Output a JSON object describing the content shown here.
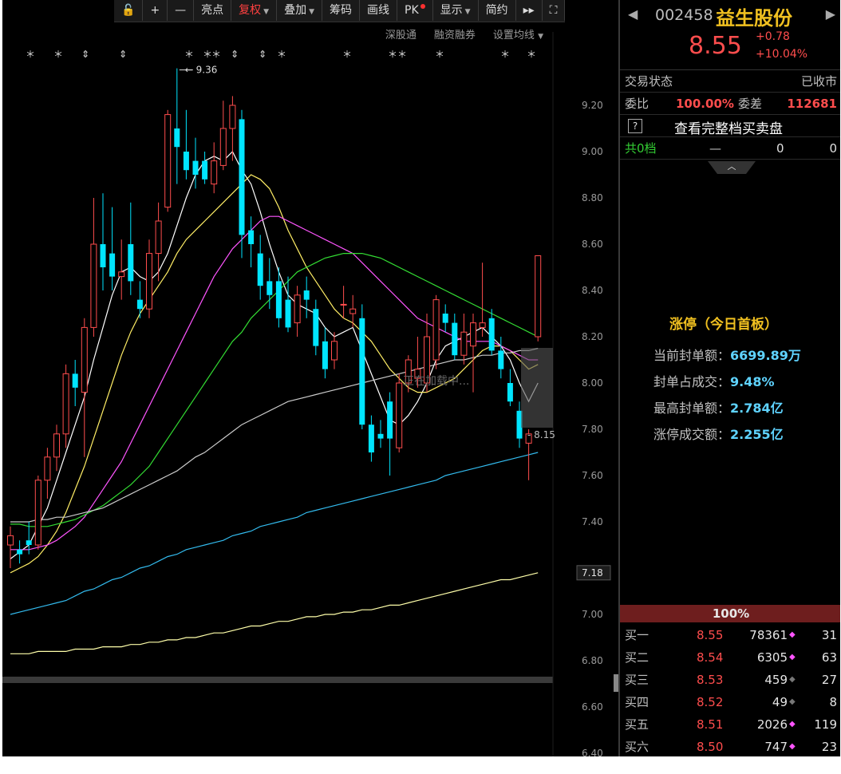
{
  "toolbar": {
    "items": [
      {
        "label": "亮点",
        "caret": false,
        "active": false
      },
      {
        "label": "复权",
        "caret": true,
        "active": true
      },
      {
        "label": "叠加",
        "caret": true,
        "active": false
      },
      {
        "label": "筹码",
        "caret": false,
        "active": false
      },
      {
        "label": "画线",
        "caret": false,
        "active": false
      },
      {
        "label": "PK",
        "caret": false,
        "active": false,
        "dot": true
      },
      {
        "label": "显示",
        "caret": true,
        "active": false
      },
      {
        "label": "简约",
        "caret": false,
        "active": false
      }
    ],
    "icons": [
      "lock-icon",
      "zoom-in-icon",
      "zoom-out-icon",
      "fast-forward-icon",
      "fullscreen-icon"
    ]
  },
  "subtool": {
    "items": [
      "深股通",
      "融资融券",
      "设置均线"
    ]
  },
  "chart_data": {
    "type": "candlestick",
    "y_ticks": [
      "9.20",
      "9.00",
      "8.80",
      "8.60",
      "8.40",
      "8.20",
      "8.00",
      "7.80",
      "7.60",
      "7.40",
      "7.00",
      "6.80",
      "6.60",
      "6.40"
    ],
    "y_tick_values": [
      9.2,
      9.0,
      8.8,
      8.6,
      8.4,
      8.2,
      8.0,
      7.8,
      7.6,
      7.4,
      7.0,
      6.8,
      6.6,
      6.4
    ],
    "ylim": [
      6.4,
      9.2
    ],
    "current_price_label": "7.18",
    "high_annotation": "9.36",
    "low_annotation": "8.15",
    "loading_text": "正在加载中...",
    "colors": {
      "up": "#ff4d4d",
      "down": "#00e5ff",
      "ma5": "#ffffff",
      "ma10": "#ffee66",
      "ma20": "#ff55ff",
      "ma30": "#33dd33",
      "ma60": "#cccccc",
      "ma120": "#33bbee",
      "ma250": "#ffffaa"
    },
    "candles": [
      {
        "o": 7.3,
        "h": 7.38,
        "l": 7.2,
        "c": 7.34
      },
      {
        "o": 7.28,
        "h": 7.32,
        "l": 7.22,
        "c": 7.26
      },
      {
        "o": 7.32,
        "h": 7.4,
        "l": 7.26,
        "c": 7.3
      },
      {
        "o": 7.3,
        "h": 7.6,
        "l": 7.28,
        "c": 7.58
      },
      {
        "o": 7.58,
        "h": 7.72,
        "l": 7.5,
        "c": 7.68
      },
      {
        "o": 7.68,
        "h": 7.82,
        "l": 7.62,
        "c": 7.78
      },
      {
        "o": 7.78,
        "h": 8.08,
        "l": 7.72,
        "c": 8.04
      },
      {
        "o": 8.04,
        "h": 8.1,
        "l": 7.9,
        "c": 7.98
      },
      {
        "o": 7.96,
        "h": 8.28,
        "l": 7.68,
        "c": 8.24
      },
      {
        "o": 8.24,
        "h": 8.8,
        "l": 8.2,
        "c": 8.6
      },
      {
        "o": 8.6,
        "h": 8.82,
        "l": 8.4,
        "c": 8.5
      },
      {
        "o": 8.56,
        "h": 8.76,
        "l": 8.4,
        "c": 8.46
      },
      {
        "o": 8.46,
        "h": 8.62,
        "l": 8.36,
        "c": 8.48
      },
      {
        "o": 8.6,
        "h": 8.78,
        "l": 8.38,
        "c": 8.44
      },
      {
        "o": 8.36,
        "h": 8.44,
        "l": 8.28,
        "c": 8.32
      },
      {
        "o": 8.32,
        "h": 8.62,
        "l": 8.28,
        "c": 8.56
      },
      {
        "o": 8.56,
        "h": 8.78,
        "l": 8.44,
        "c": 8.7
      },
      {
        "o": 8.76,
        "h": 9.18,
        "l": 8.74,
        "c": 9.16
      },
      {
        "o": 9.1,
        "h": 9.36,
        "l": 8.86,
        "c": 9.02
      },
      {
        "o": 9.0,
        "h": 9.18,
        "l": 8.88,
        "c": 8.92
      },
      {
        "o": 8.96,
        "h": 9.06,
        "l": 8.84,
        "c": 8.9
      },
      {
        "o": 8.96,
        "h": 9.0,
        "l": 8.86,
        "c": 8.88
      },
      {
        "o": 8.86,
        "h": 9.04,
        "l": 8.82,
        "c": 8.96
      },
      {
        "o": 8.94,
        "h": 9.22,
        "l": 8.92,
        "c": 9.1
      },
      {
        "o": 9.1,
        "h": 9.24,
        "l": 8.96,
        "c": 9.2
      },
      {
        "o": 9.14,
        "h": 9.18,
        "l": 8.54,
        "c": 8.64
      },
      {
        "o": 8.66,
        "h": 8.72,
        "l": 8.5,
        "c": 8.6
      },
      {
        "o": 8.56,
        "h": 8.64,
        "l": 8.36,
        "c": 8.42
      },
      {
        "o": 8.44,
        "h": 8.54,
        "l": 8.32,
        "c": 8.38
      },
      {
        "o": 8.44,
        "h": 8.5,
        "l": 8.24,
        "c": 8.28
      },
      {
        "o": 8.36,
        "h": 8.46,
        "l": 8.22,
        "c": 8.24
      },
      {
        "o": 8.26,
        "h": 8.42,
        "l": 8.2,
        "c": 8.38
      },
      {
        "o": 8.4,
        "h": 8.46,
        "l": 8.28,
        "c": 8.36
      },
      {
        "o": 8.32,
        "h": 8.36,
        "l": 8.12,
        "c": 8.16
      },
      {
        "o": 8.18,
        "h": 8.24,
        "l": 8.02,
        "c": 8.06
      },
      {
        "o": 8.1,
        "h": 8.22,
        "l": 8.06,
        "c": 8.18
      },
      {
        "o": 8.34,
        "h": 8.42,
        "l": 8.28,
        "c": 8.34
      },
      {
        "o": 8.3,
        "h": 8.38,
        "l": 8.24,
        "c": 8.32
      },
      {
        "o": 8.28,
        "h": 8.34,
        "l": 7.8,
        "c": 7.82
      },
      {
        "o": 7.82,
        "h": 7.86,
        "l": 7.66,
        "c": 7.7
      },
      {
        "o": 7.78,
        "h": 7.84,
        "l": 7.72,
        "c": 7.76
      },
      {
        "o": 7.92,
        "h": 7.96,
        "l": 7.6,
        "c": 7.76
      },
      {
        "o": 7.72,
        "h": 8.04,
        "l": 7.7,
        "c": 8.0
      },
      {
        "o": 8.0,
        "h": 8.12,
        "l": 7.96,
        "c": 8.1
      },
      {
        "o": 8.02,
        "h": 8.2,
        "l": 7.98,
        "c": 8.06
      },
      {
        "o": 8.0,
        "h": 8.3,
        "l": 7.96,
        "c": 8.2
      },
      {
        "o": 8.1,
        "h": 8.38,
        "l": 8.06,
        "c": 8.36
      },
      {
        "o": 8.3,
        "h": 8.34,
        "l": 8.22,
        "c": 8.26
      },
      {
        "o": 8.26,
        "h": 8.3,
        "l": 8.1,
        "c": 8.12
      },
      {
        "o": 8.12,
        "h": 8.3,
        "l": 8.08,
        "c": 8.22
      },
      {
        "o": 8.16,
        "h": 8.3,
        "l": 7.96,
        "c": 8.26
      },
      {
        "o": 8.24,
        "h": 8.52,
        "l": 8.2,
        "c": 8.26
      },
      {
        "o": 8.28,
        "h": 8.32,
        "l": 8.12,
        "c": 8.14
      },
      {
        "o": 8.14,
        "h": 8.2,
        "l": 8.02,
        "c": 8.06
      },
      {
        "o": 8.0,
        "h": 8.06,
        "l": 7.9,
        "c": 7.92
      },
      {
        "o": 7.88,
        "h": 7.92,
        "l": 7.72,
        "c": 7.76
      },
      {
        "o": 7.74,
        "h": 7.8,
        "l": 7.58,
        "c": 7.78
      },
      {
        "o": 8.2,
        "h": 8.55,
        "l": 8.18,
        "c": 8.55
      }
    ],
    "ma_lines": [
      {
        "name": "ma5",
        "y": [
          7.24,
          7.27,
          7.3,
          7.38,
          7.46,
          7.58,
          7.7,
          7.82,
          7.94,
          8.1,
          8.24,
          8.38,
          8.48,
          8.5,
          8.46,
          8.44,
          8.48,
          8.56,
          8.68,
          8.8,
          8.9,
          8.96,
          8.98,
          8.96,
          9.0,
          8.92,
          8.86,
          8.74,
          8.6,
          8.48,
          8.38,
          8.34,
          8.32,
          8.3,
          8.24,
          8.2,
          8.22,
          8.24,
          8.14,
          8.04,
          7.94,
          7.84,
          7.82,
          7.86,
          7.92,
          8.0,
          8.1,
          8.16,
          8.18,
          8.2,
          8.22,
          8.24,
          8.2,
          8.16,
          8.1,
          8.0,
          7.92,
          8.0
        ]
      },
      {
        "name": "ma10",
        "y": [
          7.18,
          7.2,
          7.22,
          7.25,
          7.3,
          7.36,
          7.44,
          7.54,
          7.64,
          7.76,
          7.88,
          8.0,
          8.12,
          8.22,
          8.3,
          8.36,
          8.42,
          8.48,
          8.56,
          8.62,
          8.66,
          8.7,
          8.74,
          8.78,
          8.82,
          8.86,
          8.9,
          8.88,
          8.84,
          8.76,
          8.66,
          8.58,
          8.5,
          8.44,
          8.38,
          8.32,
          8.28,
          8.26,
          8.22,
          8.18,
          8.12,
          8.06,
          8.02,
          7.98,
          7.96,
          7.96,
          7.98,
          8.0,
          8.02,
          8.06,
          8.1,
          8.14,
          8.16,
          8.16,
          8.14,
          8.1,
          8.06,
          8.08
        ]
      },
      {
        "name": "ma20",
        "y": [
          7.28,
          7.28,
          7.28,
          7.29,
          7.3,
          7.32,
          7.35,
          7.38,
          7.42,
          7.48,
          7.54,
          7.6,
          7.66,
          7.74,
          7.82,
          7.9,
          7.98,
          8.06,
          8.14,
          8.22,
          8.3,
          8.38,
          8.46,
          8.52,
          8.58,
          8.62,
          8.66,
          8.7,
          8.72,
          8.72,
          8.7,
          8.68,
          8.66,
          8.64,
          8.62,
          8.6,
          8.58,
          8.56,
          8.52,
          8.48,
          8.44,
          8.4,
          8.36,
          8.32,
          8.28,
          8.26,
          8.24,
          8.22,
          8.2,
          8.18,
          8.18,
          8.18,
          8.18,
          8.16,
          8.14,
          8.12,
          8.1,
          8.1
        ]
      },
      {
        "name": "ma30",
        "y": [
          7.39,
          7.39,
          7.38,
          7.38,
          7.38,
          7.39,
          7.4,
          7.41,
          7.43,
          7.45,
          7.47,
          7.5,
          7.53,
          7.56,
          7.6,
          7.64,
          7.7,
          7.76,
          7.82,
          7.88,
          7.94,
          8.0,
          8.06,
          8.12,
          8.18,
          8.22,
          8.28,
          8.32,
          8.36,
          8.4,
          8.44,
          8.48,
          8.5,
          8.52,
          8.54,
          8.55,
          8.56,
          8.56,
          8.56,
          8.55,
          8.54,
          8.52,
          8.5,
          8.48,
          8.46,
          8.44,
          8.42,
          8.4,
          8.38,
          8.36,
          8.34,
          8.32,
          8.3,
          8.28,
          8.26,
          8.24,
          8.22,
          8.2
        ]
      },
      {
        "name": "ma60",
        "y": [
          7.4,
          7.4,
          7.4,
          7.41,
          7.41,
          7.42,
          7.42,
          7.43,
          7.44,
          7.45,
          7.46,
          7.48,
          7.5,
          7.52,
          7.54,
          7.56,
          7.58,
          7.6,
          7.62,
          7.65,
          7.68,
          7.7,
          7.73,
          7.76,
          7.79,
          7.82,
          7.84,
          7.86,
          7.88,
          7.9,
          7.92,
          7.93,
          7.94,
          7.95,
          7.96,
          7.97,
          7.98,
          7.99,
          8.0,
          8.01,
          8.02,
          8.03,
          8.04,
          8.05,
          8.06,
          8.07,
          8.08,
          8.09,
          8.1,
          8.1,
          8.11,
          8.12,
          8.12,
          8.13,
          8.13,
          8.14,
          8.14,
          8.15
        ]
      },
      {
        "name": "ma120",
        "y": [
          7.0,
          7.01,
          7.02,
          7.03,
          7.04,
          7.05,
          7.06,
          7.08,
          7.1,
          7.11,
          7.13,
          7.15,
          7.16,
          7.18,
          7.2,
          7.21,
          7.23,
          7.25,
          7.26,
          7.28,
          7.29,
          7.3,
          7.31,
          7.32,
          7.34,
          7.35,
          7.36,
          7.38,
          7.39,
          7.4,
          7.41,
          7.42,
          7.44,
          7.45,
          7.46,
          7.47,
          7.48,
          7.49,
          7.5,
          7.51,
          7.52,
          7.53,
          7.54,
          7.55,
          7.56,
          7.57,
          7.58,
          7.6,
          7.61,
          7.62,
          7.63,
          7.64,
          7.65,
          7.66,
          7.67,
          7.68,
          7.69,
          7.7
        ]
      },
      {
        "name": "ma250",
        "y": [
          6.83,
          6.83,
          6.83,
          6.84,
          6.84,
          6.84,
          6.84,
          6.85,
          6.85,
          6.85,
          6.86,
          6.86,
          6.86,
          6.87,
          6.87,
          6.88,
          6.88,
          6.89,
          6.89,
          6.9,
          6.9,
          6.91,
          6.92,
          6.92,
          6.93,
          6.94,
          6.95,
          6.95,
          6.96,
          6.97,
          6.97,
          6.98,
          6.99,
          6.99,
          7.0,
          7.0,
          7.01,
          7.01,
          7.02,
          7.02,
          7.03,
          7.04,
          7.04,
          7.05,
          7.06,
          7.07,
          7.08,
          7.09,
          7.1,
          7.11,
          7.12,
          7.13,
          7.14,
          7.15,
          7.15,
          7.16,
          7.17,
          7.18
        ]
      }
    ]
  },
  "panel": {
    "code": "002458",
    "name": "益生股份",
    "price": "8.55",
    "change": "+0.78",
    "change_pct": "+10.04%",
    "trade_state_label": "交易状态",
    "trade_state_value": "已收市",
    "weibi_label": "委比",
    "weibi_value": "100.00%",
    "weicha_label": "委差",
    "weicha_value": "112681",
    "view_full": "查看完整档买卖盘",
    "total_label": "共0档",
    "total_dash": "—",
    "total_a": "0",
    "total_b": "0",
    "limit_title": "涨停（今日首板）",
    "limit_rows": [
      {
        "label": "当前封单额：",
        "value": "6699.89万"
      },
      {
        "label": "封单占成交：",
        "value": "9.48%"
      },
      {
        "label": "最高封单额：",
        "value": "2.784亿"
      },
      {
        "label": "涨停成交额：",
        "value": "2.255亿"
      }
    ],
    "ratio_bar": "100%",
    "bids": [
      {
        "name": "买一",
        "price": "8.55",
        "qty": "78361",
        "orders": "31",
        "dot": "#ff55ff"
      },
      {
        "name": "买二",
        "price": "8.54",
        "qty": "6305",
        "orders": "63",
        "dot": "#ff55ff"
      },
      {
        "name": "买三",
        "price": "8.53",
        "qty": "459",
        "orders": "27",
        "dot": "#777777"
      },
      {
        "name": "买四",
        "price": "8.52",
        "qty": "49",
        "orders": "8",
        "dot": "#777777"
      },
      {
        "name": "买五",
        "price": "8.51",
        "qty": "2026",
        "orders": "119",
        "dot": "#ff55ff"
      },
      {
        "name": "买六",
        "price": "8.50",
        "qty": "747",
        "orders": "23",
        "dot": "#ff55ff"
      }
    ]
  }
}
